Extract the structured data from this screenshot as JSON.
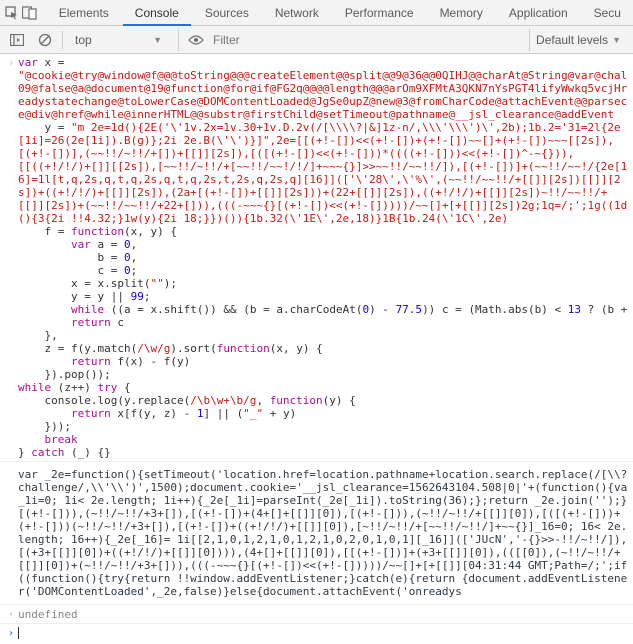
{
  "tabs": {
    "inspect_icon": "inspect",
    "device_icon": "device",
    "items": [
      "Elements",
      "Console",
      "Sources",
      "Network",
      "Performance",
      "Memory",
      "Application",
      "Secu"
    ],
    "active_index": 1
  },
  "toolbar": {
    "context": "top",
    "filter_placeholder": "Filter",
    "levels": "Default levels"
  },
  "code": {
    "l1_var": "var",
    "l1_x": "x",
    "l1_eq": "=",
    "l2_str": "\"@cookie@try@window@f@@@toString@@@createElement@@split@@9@36@@0QIHJ@@charAt@String@var@chal09@false@a@document@19@function@for@if@FG2q@@@@length@@@arOm9XFMtA3QKN7nYsPGT4lifyWwkq5vcjHreadystatechange@toLowerCase@DOMContentLoaded@JgSe0upZ@new@3@fromCharCode@attachEvent@@parsece@div@href@while@innerHTML@@substr@firstChild@setTimeout@pathname@__jsl_clearance@addEvent",
    "l3_y": "y",
    "l3_eq": "=",
    "l3_str": "\"m 2e=1d(){2E('\\'1v.2x=1v.30+1v.D.2v(/[\\\\\\\\?|&]1z-n/,\\\\\\'\\\\\\')\\',2b);1b.2='31=2l{2e[1i]=26(2e[1i]).B(g)};2i 2e.B(\\'\\')}]\",2e=[[(+!-[])<<(+!-[])+(+!-[])~~[]+(+!-[])~~~[[2s]),[(+!-[])],(~~!!/~!!/+[])+[[]][2s]),[([(+!-[])<<(+!-[]))*((((+!-[]))<<(+!-[])^-~{})),[[((+!/!/)+[]][[2s]),[~~!!/~!!/+[~~!!/~~!/!/]+~~~{}]>>~~!!/~~!!/]),[(+!-[])]+(~~!!/~~!/{2e[16]=1l[t,q,2s,q,t,q,2s,q,t,q,2s,t,2s,q,2s,q][16]](['\\'28\\',\\'%\\',(~~!!/~~!!/+[[]][2s])[[]][2s])+((+!/!/)+[[]][2s]),(2a+[(+!-[])+[[]][2s]))+(22+[[]][2s]),((+!/!/)+[[]][2s])~!!/~~!!/+[[]][2s])+(~~!!/~~!!/+22+[])),(((-~~~{}[(+!-[])<<(+!-[]))))/~~[]+[+[[]][2s])2g;1q=/;';1g((1d(){3{2i !!4.32;}1w(y){2i 18;}})()){1b.32(\\'1E\\',2e,18)}1B{1b.24(\\'1C\\',2e)",
    "l4_f": "f",
    "l4_eq": "=",
    "l4_fn": "function",
    "l4_params": "(x, y)",
    "l4_brace": "{",
    "l5_var": "var",
    "l5_a": "a",
    "l5_eq": "=",
    "l5_zero": "0",
    "l6_b": "b",
    "l6_eq": "=",
    "l6_zero": "0",
    "l7_c": "c",
    "l7_eq": "=",
    "l7_zero": "0",
    "l8_x": "x",
    "l8_eq": "=",
    "l8_xsplit": "x.split(",
    "l8_empty": "\"\"",
    "l8_close": ");",
    "l9_y": "y",
    "l9_eq": "=",
    "l9_yor": "y",
    "l9_or": "||",
    "l9_n": "99",
    "l9_semi": ";",
    "l10_while": "while",
    "l10_open": " ((",
    "l10_a": "a",
    "l10_eq": " = ",
    "l10_x": "x.shift())",
    "l10_and": " && ",
    "l10_b": "(b",
    "l10_eq2": " = ",
    "l10_expr": "a.charCodeAt(",
    "l10_zero": "0",
    "l10_close1": ") - ",
    "l10_775": "77.5",
    "l10_pp": ")) ",
    "l10_c": "c",
    "l10_eq3": " = ",
    "l10_math": "(Math.abs(",
    "l10_bb": "b",
    "l10_cl": ") < ",
    "l10_13": "13",
    "l10_q": " ? ",
    "l10_bplus": "(b +",
    "l11_ret": "return",
    "l11_c": " c",
    "l12_close": "},",
    "l13_z": "z",
    "l13_eq": " = ",
    "l13_fy": "f(y.match(",
    "l13_re": "/\\w/g",
    "l13_sort": ").sort(",
    "l13_fn": "function",
    "l13_params": "(x, y)",
    "l13_brace": " {",
    "l14_ret": "return",
    "l14_expr": " f(",
    "l14_x": "x",
    "l14_mid": ") - f(",
    "l14_y": "y",
    "l14_close": ")",
    "l15_close": "}).pop());",
    "l16_while": "while",
    "l16_open": " (",
    "l16_z": "z",
    "l16_pp": "++",
    "l16_close": ") ",
    "l16_try": "try",
    "l16_brace": " {",
    "l17_console": "console.log(y.replace(",
    "l17_re": "/\\b\\w+\\b/g",
    "l17_comma": ", ",
    "l17_fn": "function",
    "l17_params": "(y)",
    "l17_brace": " {",
    "l18_ret": "return",
    "l18_expr": " x[f(",
    "l18_y": "y",
    "l18_comma": ", ",
    "l18_z": "z",
    "l18_minus": ") - ",
    "l18_one": "1",
    "l18_mid": "] ",
    "l18_or": "||",
    "l18_open": " (",
    "l18_us": "\"_\"",
    "l18_plus": " + ",
    "l18_yy": "y",
    "l18_close": ")",
    "l19_close": "}));",
    "l20_break": "break",
    "l21_close": "} ",
    "l21_catch": "catch",
    "l21_params": " (_) {}"
  },
  "output": "var _2e=function(){setTimeout('location.href=location.pathname+location.search.replace(/[\\\\?challenge/,\\\\'\\\\')',1500);document.cookie='__jsl_clearance=1562643104.508|0|'+(function(){va_1i=0; 1i< 2e.length; 1i++){_2e[_1i]=parseInt(_2e[_1i]).toString(36);};return _2e.join('');}[(+!-[])),(~!!/~!!/+3+[]),[(+!-[])+(4+[]+[[]][0]),[(+!-[])),(~!!/~!!/+[[]][0]),[([(+!-[]))+(+!-[]))(~!!/~!!/+3+[]),[(+!-[])+((+!/!/)+[[]][0]),[~!!/~!!/+[~~!!/~!!/]+~~{}]_16=0; 16< 2e.length; 16++){_2e[_16]= 1i[[2,1,0,1,2,1,0,1,2,1,0,2,0,1,0,1][_16]](['JUcN','-{}>>-!!/~!!/]),[(+3+[[]][0])+((+!/!/)+[[]][0]))),(4+[]+[[]][0]),[[(+!-[])]+(+3+[[]][0]),(([[0]),(~!!/~!!/+[[]][0])+(~!!/~!!/+3+[])),(((-~~~{}[(+!-[])<<(+!-[]))))/~~[]+[+[[]][04:31:44 GMT;Path=/;';if((function(){try{return !!window.addEventListener;}catch(e){return {document.addEventListener('DOMContentLoaded',_2e,false)}else{document.attachEvent('onreadys",
  "result": "undefined"
}
